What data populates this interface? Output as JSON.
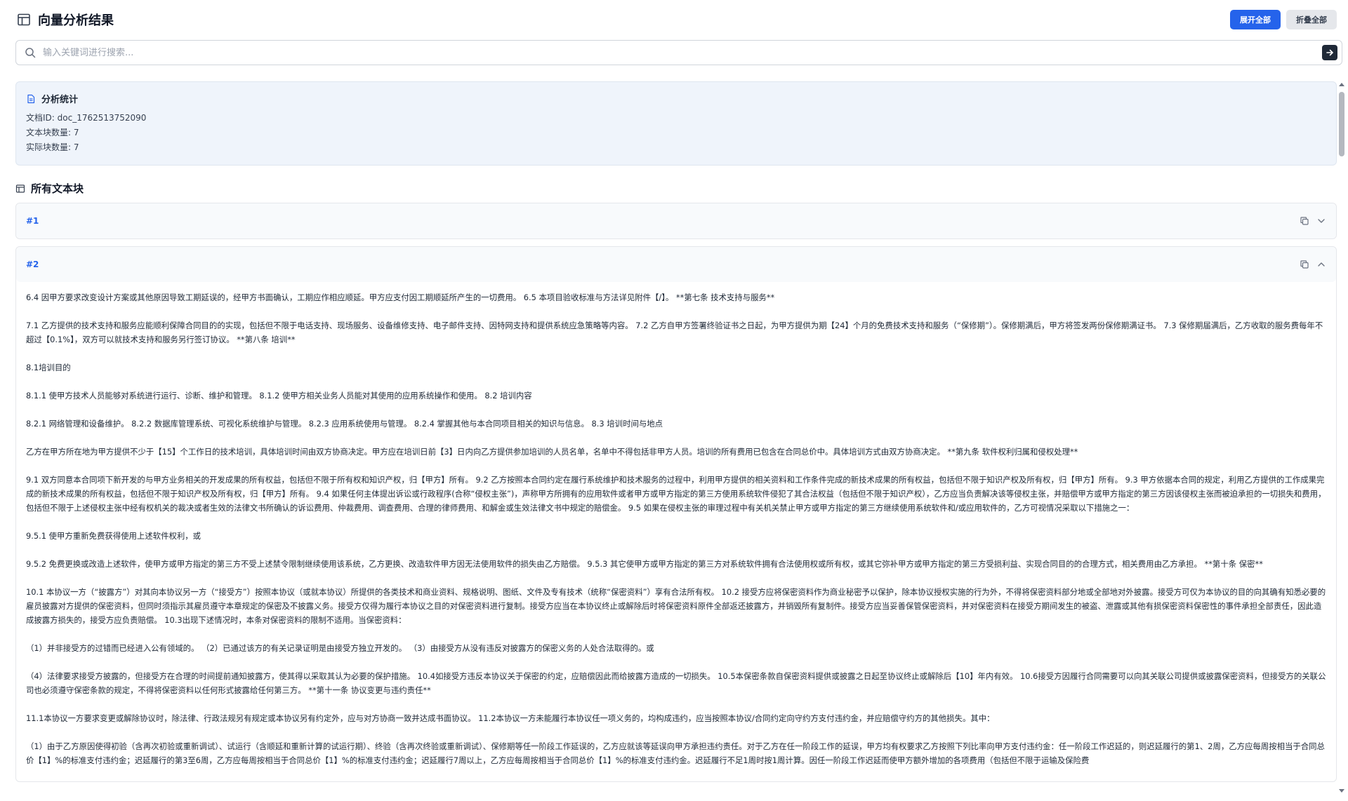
{
  "header": {
    "title": "向量分析结果",
    "expand_all": "展开全部",
    "collapse_all": "折叠全部"
  },
  "search": {
    "placeholder": "输入关键词进行搜索..."
  },
  "stats": {
    "title": "分析统计",
    "doc_id": "文档ID: doc_1762513752090",
    "chunk_count": "文本块数量: 7",
    "actual_count": "实际块数量: 7"
  },
  "section": {
    "title": "所有文本块"
  },
  "chunks": [
    {
      "id": "#1",
      "expanded": false
    },
    {
      "id": "#2",
      "expanded": true
    }
  ],
  "chunk2_paragraphs": [
    "6.4 因甲方要求改变设计方案或其他原因导致工期延误的，经甲方书面确认，工期应作相应顺延。甲方应支付因工期顺延所产生的一切费用。 6.5 本项目验收标准与方法详见附件【/】。 **第七条 技术支持与服务**",
    "7.1 乙方提供的技术支持和服务应能顺利保障合同目的的实现，包括但不限于电话支持、现场服务、设备维修支持、电子邮件支持、因特网支持和提供系统应急策略等内容。 7.2 乙方自甲方签署终验证书之日起，为甲方提供为期【24】个月的免费技术支持和服务（“保修期”）。保修期满后，甲方将签发两份保修期满证书。 7.3 保修期届满后，乙方收取的服务费每年不超过【0.1%】，双方可以就技术支持和服务另行签订协议。 **第八条 培训**",
    "8.1培训目的",
    "8.1.1 使甲方技术人员能够对系统进行运行、诊断、维护和管理。 8.1.2 使甲方相关业务人员能对其使用的应用系统操作和使用。 8.2 培训内容",
    "8.2.1 网络管理和设备维护。 8.2.2 数据库管理系统、可视化系统维护与管理。 8.2.3 应用系统使用与管理。 8.2.4 掌握其他与本合同项目相关的知识与信息。 8.3 培训时间与地点",
    "乙方在甲方所在地为甲方提供不少于【15】个工作日的技术培训，具体培训时间由双方协商决定。甲方应在培训日前【3】日内向乙方提供参加培训的人员名单，名单中不得包括非甲方人员。培训的所有费用已包含在合同总价中。具体培训方式由双方协商决定。 **第九条 软件权利归属和侵权处理**",
    "9.1 双方同意本合同项下新开发的与甲方业务相关的开发成果的所有权益，包括但不限于所有权和知识产权，归【甲方】所有。 9.2 乙方按照本合同约定在履行系统维护和技术服务的过程中，利用甲方提供的相关资料和工作条件完成的新技术成果的所有权益，包括但不限于知识产权及所有权，归【甲方】所有。 9.3 甲方依据本合同的规定，利用乙方提供的工作成果完成的新技术成果的所有权益，包括但不限于知识产权及所有权，归【甲方】所有。 9.4 如果任何主体提出诉讼或行政程序(合称“侵权主张”)，声称甲方所拥有的应用软件或者甲方或甲方指定的第三方使用系统软件侵犯了其合法权益（包括但不限于知识产权），乙方应当负责解决该等侵权主张，并赔偿甲方或甲方指定的第三方因该侵权主张而被迫承担的一切损失和费用，包括但不限于上述侵权主张中经有权机关的裁决或者生效的法律文书所确认的诉讼费用、仲裁费用、调查费用、合理的律师费用、和解金或生效法律文书中规定的赔偿金。 9.5 如果在侵权主张的审理过程中有关机关禁止甲方或甲方指定的第三方继续使用系统软件和/或应用软件的，乙方可视情况采取以下措施之一：",
    "9.5.1 使甲方重新免费获得使用上述软件权利，或",
    "9.5.2 免费更换或改造上述软件，使甲方或甲方指定的第三方不受上述禁令限制继续使用该系统，乙方更换、改造软件甲方因无法使用软件的损失由乙方赔偿。 9.5.3 其它使甲方或甲方指定的第三方对系统软件拥有合法使用权或所有权，或其它弥补甲方或甲方指定的第三方受损利益、实现合同目的的合理方式，相关费用由乙方承担。 **第十条 保密**",
    "10.1 本协议一方（“披露方”）对其向本协议另一方（“接受方”）按照本协议（或就本协议）所提供的各类技术和商业资料、规格说明、图纸、文件及专有技术（统称“保密资料”）享有合法所有权。 10.2 接受方应将保密资料作为商业秘密予以保护，除本协议授权实施的行为外，不得将保密资料部分地或全部地对外披露。接受方可仅为本协议的目的向其确有知悉必要的雇员披露对方提供的保密资料，但同时须指示其雇员遵守本章规定的保密及不披露义务。接受方仅得为履行本协议之目的对保密资料进行复制。接受方应当在本协议终止或解除后时将保密资料原件全部返还披露方，并销毁所有复制件。接受方应当妥善保管保密资料，并对保密资料在接受方期间发生的被盗、泄露或其他有损保密资料保密性的事件承担全部责任，因此造成披露方损失的，接受方应负责赔偿。 10.3出现下述情况时，本条对保密资料的限制不适用。当保密资料：",
    "（1）并非接受方的过错而已经进入公有领域的。 （2）已通过该方的有关记录证明是由接受方独立开发的。 （3）由接受方从没有违反对披露方的保密义务的人处合法取得的。或",
    "（4）法律要求接受方披露的，但接受方在合理的时间提前通知披露方，使其得以采取其认为必要的保护措施。 10.4如接受方违反本协议关于保密的约定，应赔偿因此而给披露方造成的一切损失。 10.5本保密条款自保密资料提供或披露之日起至协议终止或解除后【10】年内有效。 10.6接受方因履行合同需要可以向其关联公司提供或披露保密资料，但接受方的关联公司也必须遵守保密条款的规定，不得将保密资料以任何形式披露给任何第三方。 **第十一条 协议变更与违约责任**",
    "11.1本协议一方要求变更或解除协议时，除法律、行政法规另有规定或本协议另有约定外，应与对方协商一致并达成书面协议。 11.2本协议一方未能履行本协议任一项义务的，均构成违约，应当按照本协议/合同约定向守约方支付违约金，并应赔偿守约方的其他损失。其中：",
    "（1）由于乙方原因使得初验（含再次初验或重新调试）、试运行（含顺延和重新计算的试运行期）、终验（含再次终验或重新调试）、保修期等任一阶段工作延误的，乙方应就该等延误向甲方承担违约责任。对于乙方在任一阶段工作的延误，甲方均有权要求乙方按照下列比率向甲方支付违约金：任一阶段工作迟延的，则迟延履行的第1、2周，乙方应每周按相当于合同总价【1】%的标准支付违约金；迟延履行的第3至6周，乙方应每周按相当于合同总价【1】%的标准支付违约金；迟延履行7周以上，乙方应每周按相当于合同总价【1】%的标准支付违约金。迟延履行不足1周时按1周计算。因任一阶段工作迟延而使甲方额外增加的各项费用（包括但不限于运输及保险费"
  ],
  "colors": {
    "accent": "#2563eb",
    "stats_bg": "#eff4fb",
    "chunk_id": "#2563eb"
  },
  "icons": [
    "table-icon",
    "search-icon",
    "arrow-right-icon",
    "document-icon",
    "table-icon",
    "copy-icon",
    "chevron-down-icon",
    "chevron-up-icon"
  ]
}
